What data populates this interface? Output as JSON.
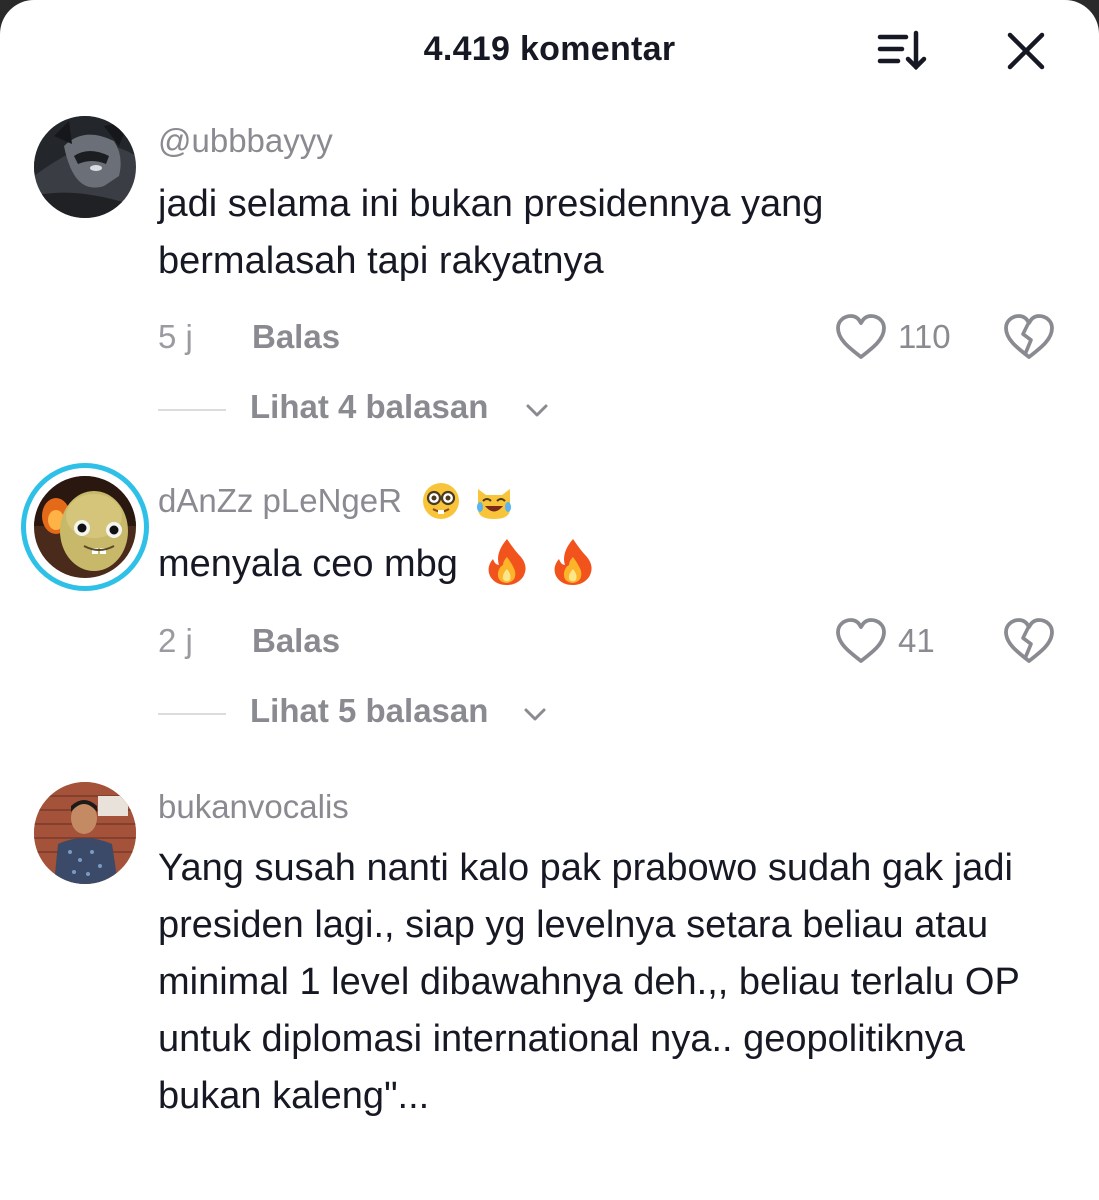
{
  "header": {
    "title": "4.419 komentar",
    "sort_icon": "sort-icon",
    "close_icon": "close-icon"
  },
  "comments": [
    {
      "username": "@ubbbayyy",
      "text": "jadi selama ini bukan presidennya yang bermalasah tapi rakyatnya",
      "time": "5 j",
      "reply_label": "Balas",
      "likes": "110",
      "view_replies": "Lihat 4 balasan"
    },
    {
      "username": "dAnZz pLeNgeR",
      "username_emojis": [
        "nerd-face-emoji",
        "laughing-cat-emoji"
      ],
      "text": "menyala ceo mbg",
      "text_emojis": [
        "fire-emoji",
        "fire-emoji"
      ],
      "time": "2 j",
      "reply_label": "Balas",
      "likes": "41",
      "view_replies": "Lihat 5 balasan",
      "has_story_ring": true
    },
    {
      "username": "bukanvocalis",
      "text": "Yang susah nanti kalo pak prabowo sudah gak jadi presiden lagi., siap yg levelnya setara beliau atau minimal 1 level dibawahnya deh.,, beliau terlalu OP untuk diplomasi international nya.. geopolitiknya bukan kaleng\"..."
    }
  ],
  "colors": {
    "primary_text": "#161823",
    "secondary_text": "#8a8b91",
    "story_ring": "#2fc0e8"
  }
}
